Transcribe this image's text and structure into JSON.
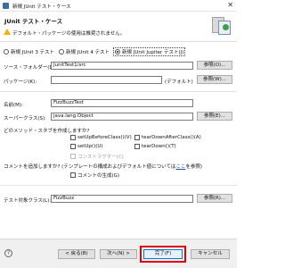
{
  "window": {
    "title": "新規 JUnit テスト・ケース",
    "close_glyph": "✕"
  },
  "header": {
    "title": "JUnit テスト・ケース",
    "warning": "デフォルト・パッケージの使用は推奨されません。"
  },
  "junit_version": {
    "options": [
      "新規 JUnit 3 テスト",
      "新規 JUnit 4 テスト",
      "新規 JUnit Jupiter テスト(J)"
    ],
    "selected": "新規 JUnit Jupiter テスト(J)"
  },
  "source_folder": {
    "label": "ソース・フォルダー(D):",
    "value": "JunitTest1/src",
    "browse": "参照(O)..."
  },
  "package": {
    "label": "パッケージ(K):",
    "value": "",
    "default_note": "(デフォルト)",
    "browse": "参照(W)..."
  },
  "name": {
    "label": "名前(M):",
    "value": "FizzBuzzTest"
  },
  "superclass": {
    "label": "スーパークラス(S):",
    "value": "java.lang.Object",
    "browse": "参照(E)..."
  },
  "stubs": {
    "question": "どのメソッド・スタブを作成しますか?",
    "items": [
      "setUpBeforeClass()(V)",
      "tearDownAfterClass()(A)",
      "setUp()(U)",
      "tearDown()(T)",
      "コンストラクター(C)"
    ]
  },
  "comments": {
    "question_before": "コメントを追加しますか? (テンプレートの構成およびデフォルト値については",
    "link": "ここ",
    "question_after": "を参照)",
    "checkbox": "コメントの生成(G)"
  },
  "class_under_test": {
    "label": "テスト対象クラス(L):",
    "value": "FizzBuzz",
    "browse": "参照(R)..."
  },
  "footer": {
    "help": "?",
    "back": "< 戻る(B)",
    "next": "次へ(N) >",
    "finish": "完了(F)",
    "cancel": "キャンセル"
  }
}
